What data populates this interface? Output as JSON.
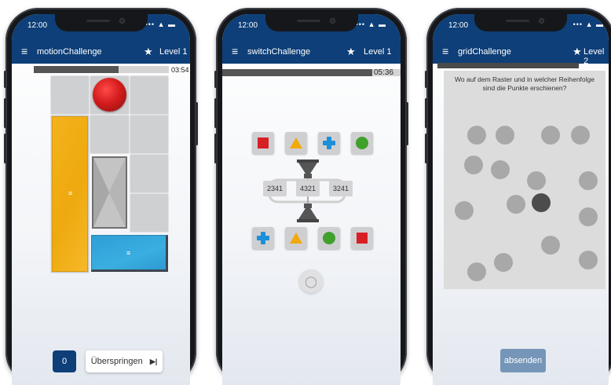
{
  "status": {
    "time": "12:00",
    "icons": "••• ▲ ▬"
  },
  "phone1": {
    "app_title": "motionChallenge",
    "level": "Level 1",
    "timer": "03:54",
    "timer_progress": 0.63,
    "counter": "0",
    "skip_label": "Überspringen",
    "skip_icon": "▶|"
  },
  "phone2": {
    "app_title": "switchChallenge",
    "level": "Level 1",
    "timer": "05:36",
    "timer_progress": 0.84,
    "top_shapes": [
      "square-red",
      "triangle-yellow",
      "plus-blue",
      "circle-green"
    ],
    "bottom_shapes": [
      "plus-blue",
      "triangle-yellow",
      "circle-green",
      "square-red"
    ],
    "switch_options": [
      "2341",
      "4321",
      "3241"
    ]
  },
  "phone3": {
    "app_title": "gridChallenge",
    "level": "Level 2",
    "timer_progress": 0.82,
    "question": "Wo auf dem Raster und in welcher Reihenfolge sind die Punkte erschienen?",
    "submit_label": "absenden"
  },
  "colors": {
    "appbar": "#0e3f78",
    "ball": "#d51d1d",
    "yellow_block": "#f5b21b",
    "blue_block": "#2f9ed6",
    "active_dot": "#4c4c4c",
    "submit": "#7596b8"
  }
}
